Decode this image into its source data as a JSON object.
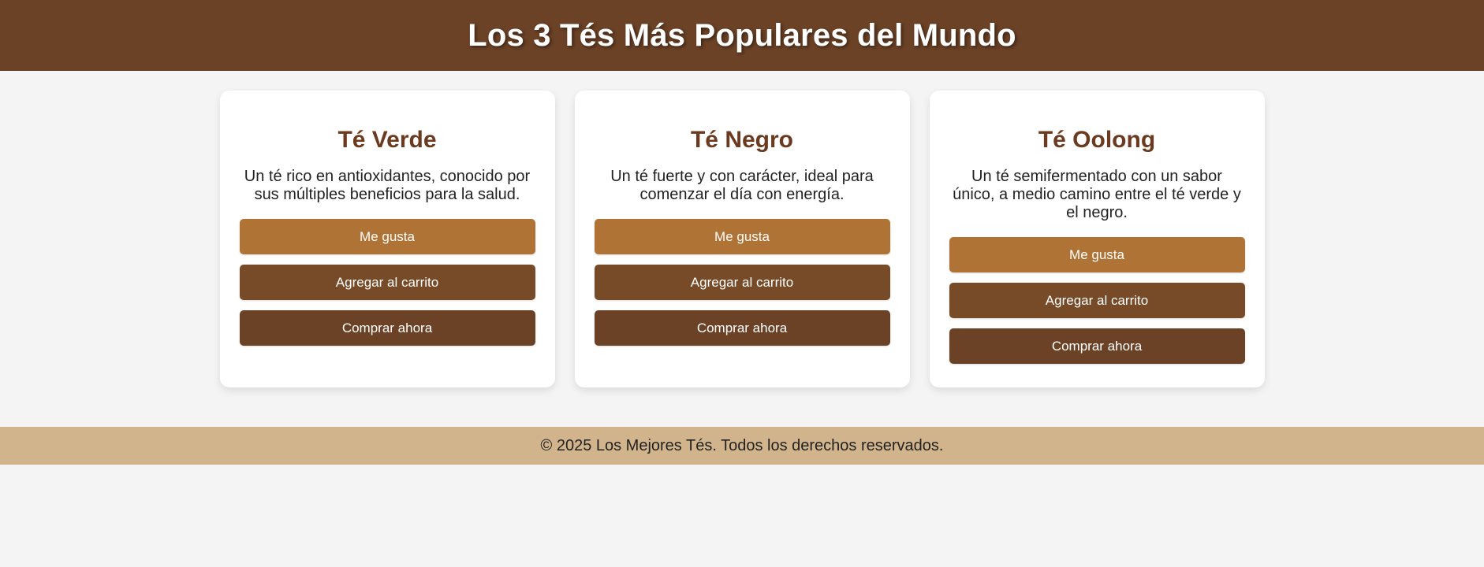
{
  "header": {
    "title": "Los 3 Tés Más Populares del Mundo"
  },
  "colors": {
    "header_bg": "#6b4226",
    "like_button": "#b07336",
    "cart_button": "#774b28",
    "buy_button": "#6b4226",
    "footer_bg": "#d2b48c",
    "page_bg": "#f4f4f4"
  },
  "cards": [
    {
      "title": "Té Verde",
      "description": "Un té rico en antioxidantes, conocido por sus múltiples beneficios para la salud.",
      "like_label": "Me gusta",
      "cart_label": "Agregar al carrito",
      "buy_label": "Comprar ahora"
    },
    {
      "title": "Té Negro",
      "description": "Un té fuerte y con carácter, ideal para comenzar el día con energía.",
      "like_label": "Me gusta",
      "cart_label": "Agregar al carrito",
      "buy_label": "Comprar ahora"
    },
    {
      "title": "Té Oolong",
      "description": "Un té semifermentado con un sabor único, a medio camino entre el té verde y el negro.",
      "like_label": "Me gusta",
      "cart_label": "Agregar al carrito",
      "buy_label": "Comprar ahora"
    }
  ],
  "footer": {
    "text": "© 2025 Los Mejores Tés. Todos los derechos reservados."
  }
}
